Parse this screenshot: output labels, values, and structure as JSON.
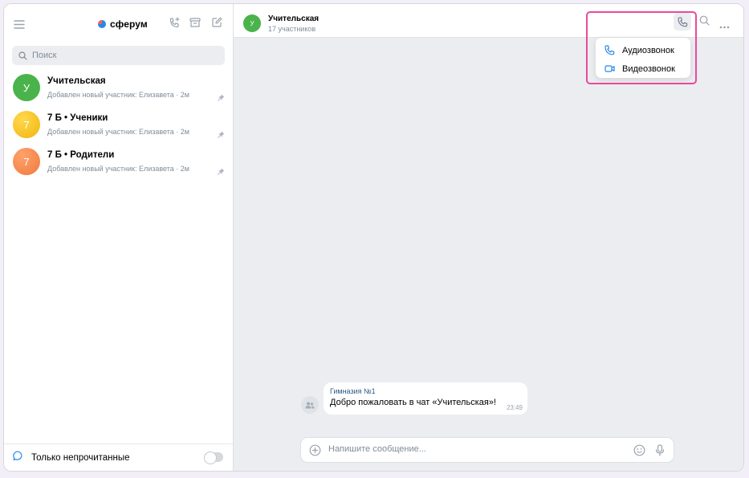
{
  "sidebar": {
    "app_name": "сферум",
    "search": {
      "placeholder": "Поиск"
    },
    "chats": [
      {
        "title": "Учительская",
        "initial": "У",
        "preview": "Добавлен новый участник: Елизавета · 2м",
        "avatar_color": "#4bb34b"
      },
      {
        "title": "7 Б • Ученики",
        "initial": "7",
        "preview": "Добавлен новый участник: Елизавета · 2м",
        "avatar_color": "#f2c029"
      },
      {
        "title": "7 Б • Родители",
        "initial": "7",
        "preview": "Добавлен новый участник: Елизавета · 2м",
        "avatar_color": "#f2844a"
      }
    ],
    "footer": {
      "unread_only_label": "Только непрочитанные",
      "toggle_on": false
    }
  },
  "chat": {
    "avatar_initial": "У",
    "title": "Учительская",
    "subtitle": "17 участников"
  },
  "call_menu": {
    "items": [
      {
        "label": "Аудиозвонок",
        "icon": "phone-icon"
      },
      {
        "label": "Видеозвонок",
        "icon": "video-icon"
      }
    ]
  },
  "messages": [
    {
      "sender": "Гимназия №1",
      "text": "Добро пожаловать в чат «Учительская»!",
      "time": "23:49"
    }
  ],
  "composer": {
    "placeholder": "Напишите сообщение..."
  },
  "colors": {
    "accent": "#2688eb",
    "highlight": "#e94a9b",
    "background": "#ebedf0"
  }
}
